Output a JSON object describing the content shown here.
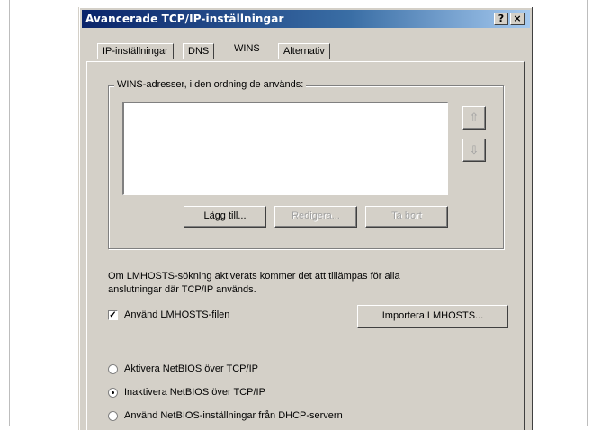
{
  "window": {
    "title": "Avancerade TCP/IP-inställningar",
    "help_glyph": "?",
    "close_glyph": "×"
  },
  "tabs": [
    {
      "label": "IP-inställningar",
      "active": false
    },
    {
      "label": "DNS",
      "active": false
    },
    {
      "label": "WINS",
      "active": true
    },
    {
      "label": "Alternativ",
      "active": false
    }
  ],
  "wins": {
    "group_label": "WINS-adresser, i den ordning de används:",
    "addresses": [],
    "up_glyph": "⇧",
    "down_glyph": "⇩",
    "buttons": {
      "add": "Lägg till...",
      "edit": "Redigera...",
      "remove": "Ta bort"
    }
  },
  "lmhosts": {
    "description_line1": "Om LMHOSTS-sökning aktiverats kommer det att tillämpas för alla",
    "description_line2": "anslutningar där TCP/IP används.",
    "checkbox_label": "Använd LMHOSTS-filen",
    "checked": true,
    "check_glyph": "✓",
    "import_button": "Importera LMHOSTS..."
  },
  "netbios": {
    "options": [
      {
        "label": "Aktivera NetBIOS över TCP/IP",
        "selected": false
      },
      {
        "label": "Inaktivera NetBIOS över TCP/IP",
        "selected": true
      },
      {
        "label": "Använd NetBIOS-inställningar från DHCP-servern",
        "selected": false
      }
    ]
  },
  "colors": {
    "dialog_face": "#d4d0c8",
    "titlebar_start": "#0a246a",
    "titlebar_end": "#a6caf0"
  }
}
